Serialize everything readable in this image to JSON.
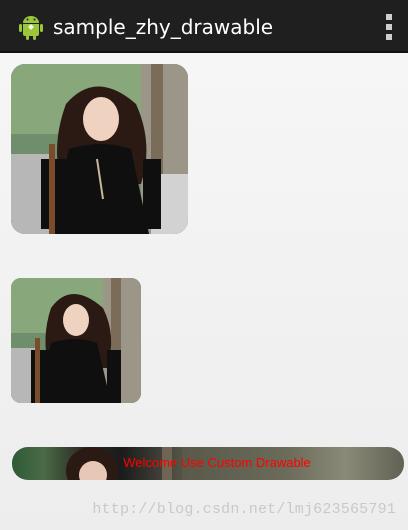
{
  "action_bar": {
    "title": "sample_zhy_drawable",
    "app_icon": "android-robot-icon",
    "overflow_icon": "more-vertical-icon",
    "background": "#1f1f1f"
  },
  "images": [
    {
      "name": "photo-large-rounded",
      "description": ""
    },
    {
      "name": "photo-small-rounded",
      "description": ""
    }
  ],
  "banner": {
    "text": "Welcome Use Custom Drawable",
    "text_color": "#ff0000"
  },
  "watermark": "http://blog.csdn.net/lmj623565791"
}
